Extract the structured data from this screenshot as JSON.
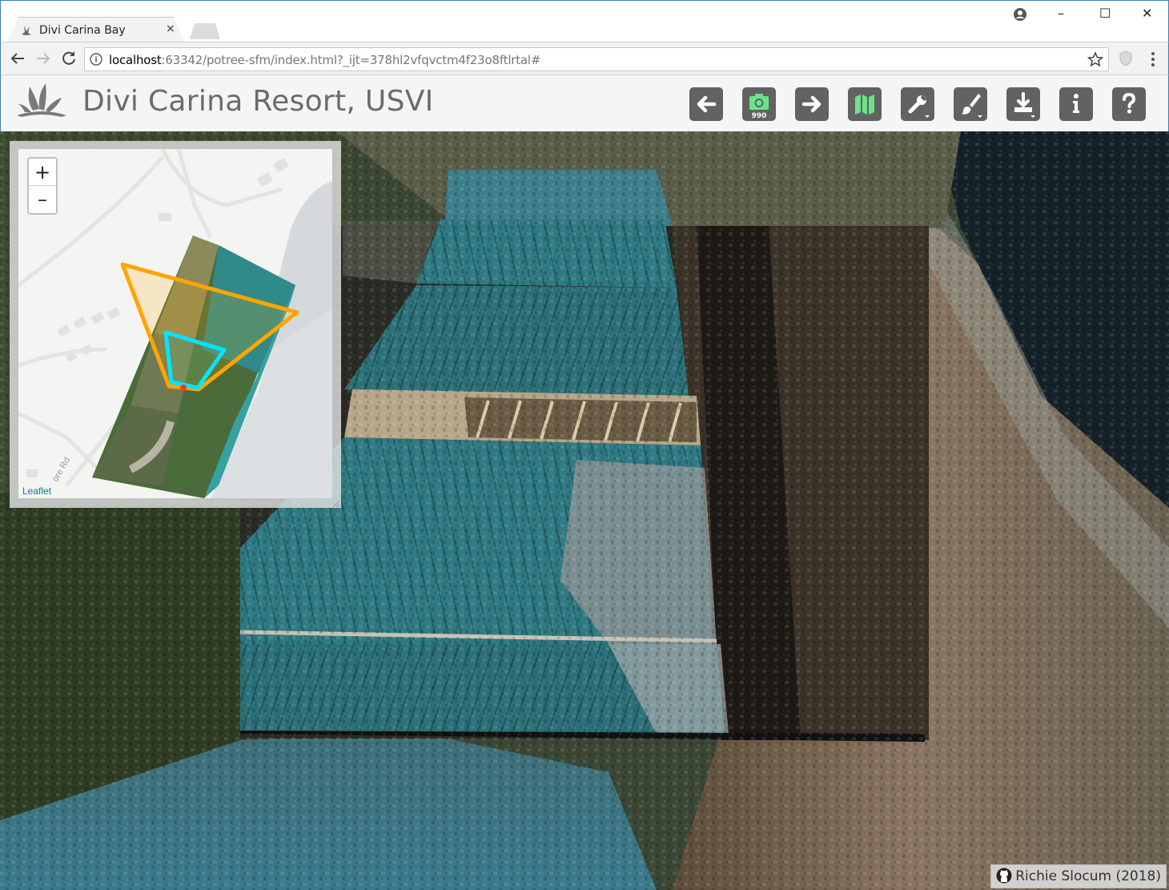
{
  "browser": {
    "tab_title": "Divi Carina Bay",
    "tab_close": "×",
    "url_host": "localhost",
    "url_rest": ":63342/potree-sfm/index.html?_ijt=378hl2vfqvctm4f23o8ftlrtal#",
    "window_controls": {
      "minimize": "–",
      "maximize": "☐",
      "close": "✕"
    }
  },
  "header": {
    "title": "Divi Carina Resort, USVI",
    "tools": [
      {
        "name": "back-button",
        "icon": "arrow-left-icon"
      },
      {
        "name": "camera-button",
        "icon": "camera-icon",
        "count": "990"
      },
      {
        "name": "forward-button",
        "icon": "arrow-right-icon"
      },
      {
        "name": "map-button",
        "icon": "map-icon",
        "accent": "#6be38a"
      },
      {
        "name": "tools-button",
        "icon": "wrench-icon"
      },
      {
        "name": "appearance-button",
        "icon": "brush-icon"
      },
      {
        "name": "download-button",
        "icon": "download-icon"
      },
      {
        "name": "info-button",
        "icon": "info-icon"
      },
      {
        "name": "help-button",
        "icon": "help-icon"
      }
    ]
  },
  "minimap": {
    "zoom_in": "+",
    "zoom_out": "–",
    "attribution": "Leaflet",
    "road_label": "ore Rd"
  },
  "credit": {
    "text": "Richie Slocum (2018)"
  },
  "colors": {
    "accent_orange": "#ffa500",
    "accent_cyan": "#00e5ff",
    "header_button": "#626262"
  }
}
